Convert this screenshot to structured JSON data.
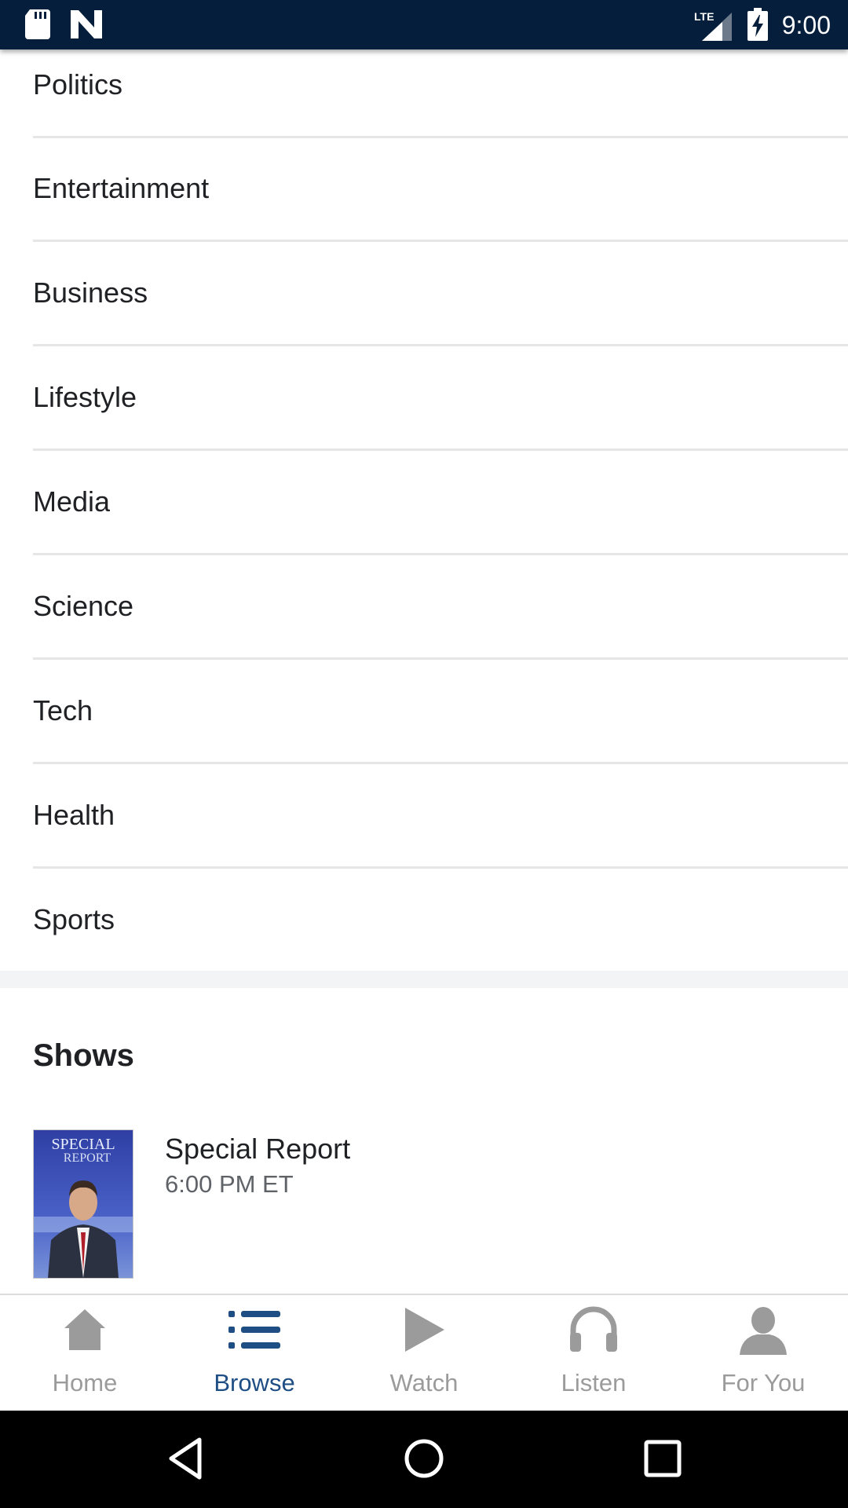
{
  "status_bar": {
    "time": "9:00",
    "network": "LTE",
    "icons": [
      "sd-card-icon",
      "n-notification-icon",
      "lte-signal-icon",
      "battery-charging-icon"
    ]
  },
  "categories": [
    {
      "label": "Politics"
    },
    {
      "label": "Entertainment"
    },
    {
      "label": "Business"
    },
    {
      "label": "Lifestyle"
    },
    {
      "label": "Media"
    },
    {
      "label": "Science"
    },
    {
      "label": "Tech"
    },
    {
      "label": "Health"
    },
    {
      "label": "Sports"
    }
  ],
  "shows": {
    "title": "Shows",
    "items": [
      {
        "name": "Special Report",
        "time": "6:00 PM ET",
        "thumb_title": "SPECIAL",
        "thumb_subtitle": "REPORT"
      }
    ]
  },
  "bottom_nav": {
    "items": [
      {
        "label": "Home",
        "icon": "home-icon",
        "active": false
      },
      {
        "label": "Browse",
        "icon": "list-icon",
        "active": true
      },
      {
        "label": "Watch",
        "icon": "play-icon",
        "active": false
      },
      {
        "label": "Listen",
        "icon": "headphones-icon",
        "active": false
      },
      {
        "label": "For You",
        "icon": "person-icon",
        "active": false
      }
    ],
    "active_color": "#1f4e85",
    "inactive_color": "#9b9b9b"
  },
  "system_nav": {
    "icons": [
      "back-icon",
      "home-circle-icon",
      "recents-icon"
    ]
  },
  "colors": {
    "status_bar_bg": "#041e3c",
    "text": "#202124",
    "divider": "#e6e6e6"
  }
}
